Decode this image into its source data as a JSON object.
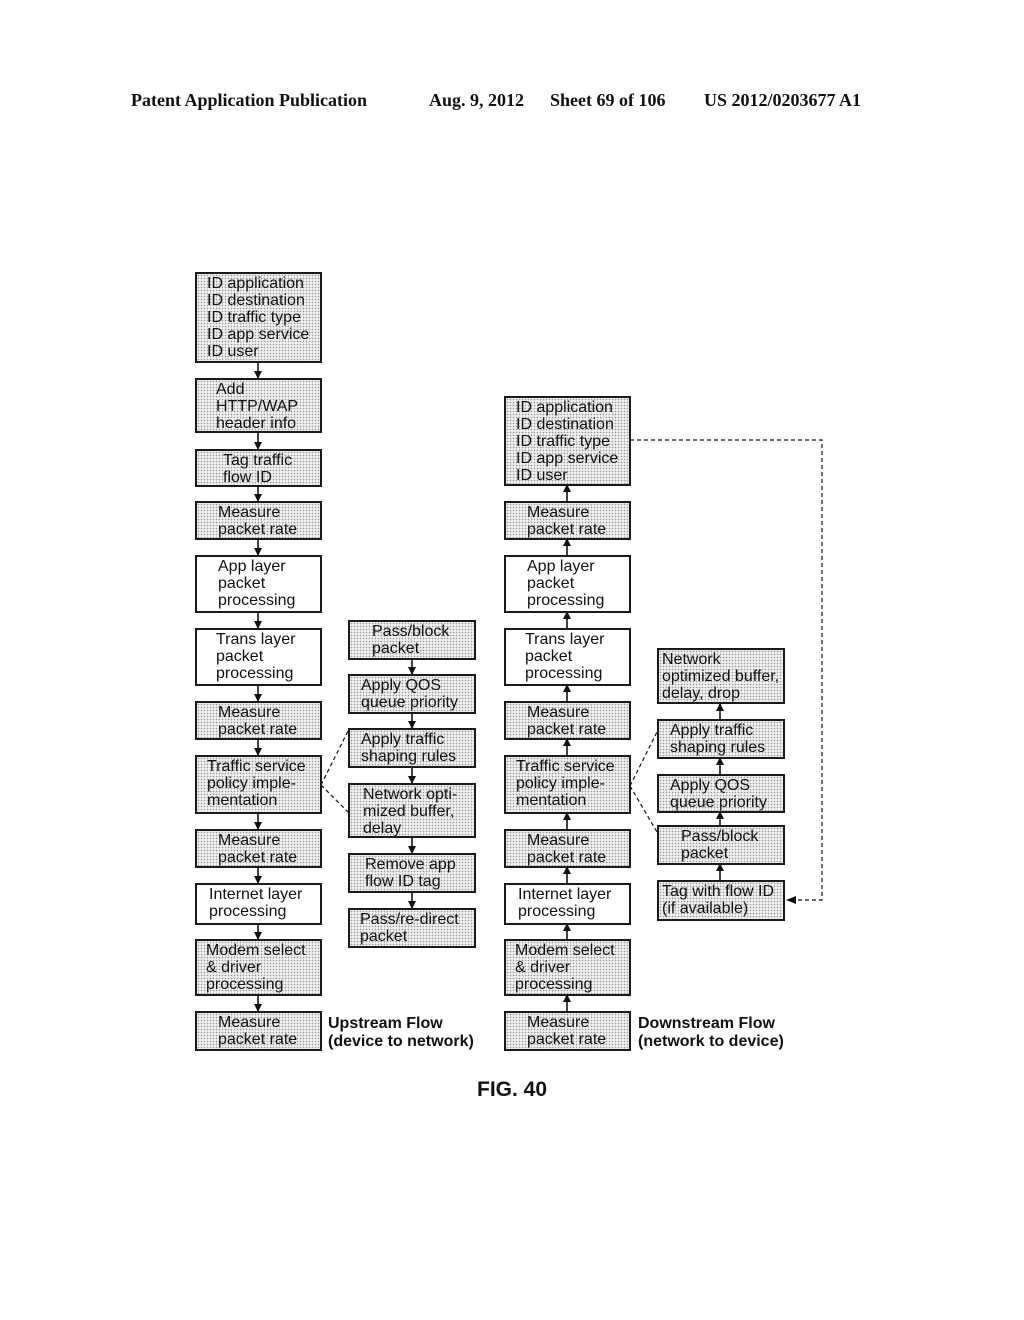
{
  "header": {
    "publication": "Patent Application Publication",
    "date": "Aug. 9, 2012",
    "sheet": "Sheet 69 of 106",
    "number": "US 2012/0203677 A1"
  },
  "upstream": {
    "label": "Upstream Flow\n(device to network)",
    "main": [
      "ID application\nID destination\nID traffic type\nID app service\nID user",
      "Add\nHTTP/WAP\nheader info",
      "Tag traffic\nflow ID",
      "Measure\npacket rate",
      "App layer\npacket\nprocessing",
      "Trans layer\npacket\nprocessing",
      "Measure\npacket rate",
      "Traffic service\npolicy imple-\nmentation",
      "Measure\npacket rate",
      "Internet layer\nprocessing",
      "Modem select\n& driver\nprocessing",
      "Measure\npacket rate"
    ],
    "side": [
      "Pass/block\npacket",
      "Apply QOS\nqueue priority",
      "Apply traffic\nshaping rules",
      "Network opti-\nmized buffer,\ndelay",
      "Remove app\nflow ID tag",
      "Pass/re-direct\npacket"
    ]
  },
  "downstream": {
    "label": "Downstream Flow\n(network to device)",
    "main": [
      "ID application\nID destination\nID traffic type\nID app service\nID user",
      "Measure\npacket rate",
      "App layer\npacket\nprocessing",
      "Trans layer\npacket\nprocessing",
      "Measure\npacket rate",
      "Traffic service\npolicy imple-\nmentation",
      "Measure\npacket rate",
      "Internet layer\nprocessing",
      "Modem select\n& driver\nprocessing",
      "Measure\npacket rate"
    ],
    "side": [
      "Network\noptimized buffer,\ndelay, drop",
      "Apply traffic\nshaping rules",
      "Apply QOS\nqueue priority",
      "Pass/block\npacket",
      "Tag with flow ID\n(if available)"
    ]
  },
  "figure_label": "FIG. 40"
}
